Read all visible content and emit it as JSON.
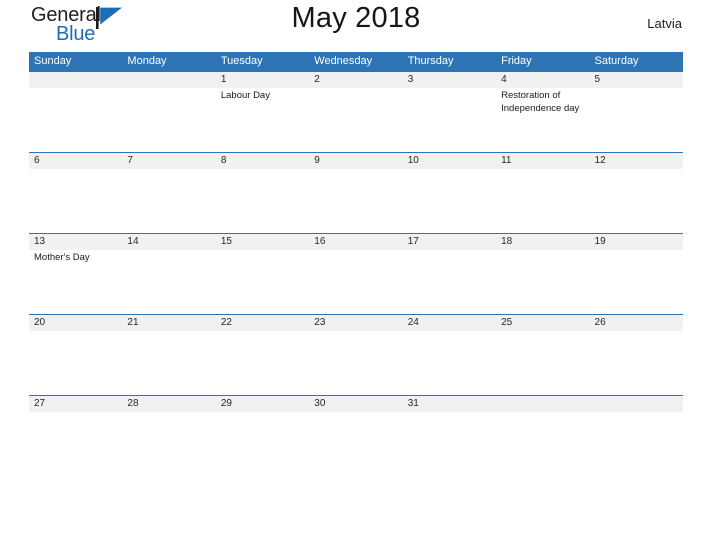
{
  "brand": {
    "name_part1": "General",
    "name_part2": "Blue",
    "mark_icon": "blue-triangle-flag-icon",
    "accent_color": "#1c6fb5"
  },
  "header": {
    "title": "May 2018",
    "country": "Latvia"
  },
  "theme": {
    "header_bar_color": "#2e74b5",
    "row_strip_color": "#f1f1f1",
    "row_border_color": "#2e74b5",
    "background": "#ffffff"
  },
  "calendar": {
    "weekdays": [
      "Sunday",
      "Monday",
      "Tuesday",
      "Wednesday",
      "Thursday",
      "Friday",
      "Saturday"
    ],
    "weeks": [
      {
        "days": [
          {
            "date": "",
            "event": ""
          },
          {
            "date": "",
            "event": ""
          },
          {
            "date": "1",
            "event": "Labour Day"
          },
          {
            "date": "2",
            "event": ""
          },
          {
            "date": "3",
            "event": ""
          },
          {
            "date": "4",
            "event": "Restoration of Independence day"
          },
          {
            "date": "5",
            "event": ""
          }
        ]
      },
      {
        "days": [
          {
            "date": "6",
            "event": ""
          },
          {
            "date": "7",
            "event": ""
          },
          {
            "date": "8",
            "event": ""
          },
          {
            "date": "9",
            "event": ""
          },
          {
            "date": "10",
            "event": ""
          },
          {
            "date": "11",
            "event": ""
          },
          {
            "date": "12",
            "event": ""
          }
        ]
      },
      {
        "days": [
          {
            "date": "13",
            "event": "Mother's Day"
          },
          {
            "date": "14",
            "event": ""
          },
          {
            "date": "15",
            "event": ""
          },
          {
            "date": "16",
            "event": ""
          },
          {
            "date": "17",
            "event": ""
          },
          {
            "date": "18",
            "event": ""
          },
          {
            "date": "19",
            "event": ""
          }
        ]
      },
      {
        "days": [
          {
            "date": "20",
            "event": ""
          },
          {
            "date": "21",
            "event": ""
          },
          {
            "date": "22",
            "event": ""
          },
          {
            "date": "23",
            "event": ""
          },
          {
            "date": "24",
            "event": ""
          },
          {
            "date": "25",
            "event": ""
          },
          {
            "date": "26",
            "event": ""
          }
        ]
      },
      {
        "days": [
          {
            "date": "27",
            "event": ""
          },
          {
            "date": "28",
            "event": ""
          },
          {
            "date": "29",
            "event": ""
          },
          {
            "date": "30",
            "event": ""
          },
          {
            "date": "31",
            "event": ""
          },
          {
            "date": "",
            "event": ""
          },
          {
            "date": "",
            "event": ""
          }
        ]
      }
    ]
  }
}
